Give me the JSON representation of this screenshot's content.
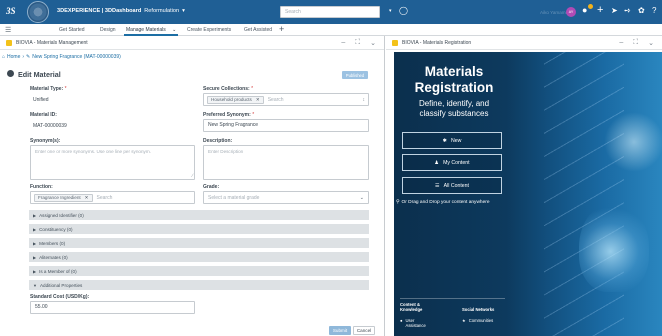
{
  "topbar": {
    "brand": "3DEXPERIENCE | 3DDashboard",
    "dashboard": "Reformulation",
    "search_placeholder": "Search",
    "user": "Aiko Yamamoto",
    "avatar_initials": "AY"
  },
  "tabs": [
    {
      "label": "Get Started"
    },
    {
      "label": "Design"
    },
    {
      "label": "Manage Materials",
      "active": true
    },
    {
      "label": "Create Experiments"
    },
    {
      "label": "Get Assisted"
    }
  ],
  "left": {
    "title": "BIOVIA - Materials Management",
    "breadcrumb": {
      "home": "Home",
      "current": "New Spring Fragrance (MAT-00000039)"
    },
    "heading": "Edit Material",
    "status": "Published",
    "fields": {
      "material_type": {
        "label": "Material Type:",
        "value": "Unified"
      },
      "secure_collections": {
        "label": "Secure Collections:",
        "tag": "Household products",
        "placeholder": "Search"
      },
      "material_id": {
        "label": "Material ID:",
        "value": "MAT-00000039"
      },
      "preferred_synonym": {
        "label": "Preferred Synonym:",
        "value": "New Spring Fragrance"
      },
      "synonyms": {
        "label": "Synonym(s):",
        "placeholder": "Enter one or more synonyms. Use one line per synonym."
      },
      "description": {
        "label": "Description:",
        "placeholder": "Enter Description"
      },
      "function": {
        "label": "Function:",
        "tag": "Fragrance Ingredient",
        "placeholder": "Search"
      },
      "grade": {
        "label": "Grade:",
        "placeholder": "Select a material grade"
      },
      "standard_cost": {
        "label": "Standard Cost (USD/Kg):",
        "value": "55.00"
      }
    },
    "sections": [
      "Assigned Identifier (0)",
      "Constituency (0)",
      "Members (0)",
      "Aliternates (0)",
      "Is a Member of (0)",
      "Additional Properties"
    ],
    "buttons": {
      "submit": "Submit",
      "cancel": "Cancel"
    }
  },
  "right": {
    "title": "BIOVIA - Materials Registration",
    "hero_title_1": "Materials",
    "hero_title_2": "Registration",
    "hero_sub_1": "Define, identify, and",
    "hero_sub_2": "classify substances",
    "btn_new": "New",
    "btn_my": "My Content",
    "btn_all": "All Content",
    "drop": "Or Drag and Drop your content anywhere",
    "footer": {
      "col1_title": "Content &",
      "col1_title2": "Knowledge",
      "col1_item": "User",
      "col1_item2": "Assistance",
      "col2_title": "Social Networks",
      "col2_item": "Communities"
    }
  },
  "colors": {
    "topbar": "#1f5f95",
    "accent": "#1c6ea4",
    "submit": "#8fb8da",
    "panel_dark": "#0b3454"
  }
}
